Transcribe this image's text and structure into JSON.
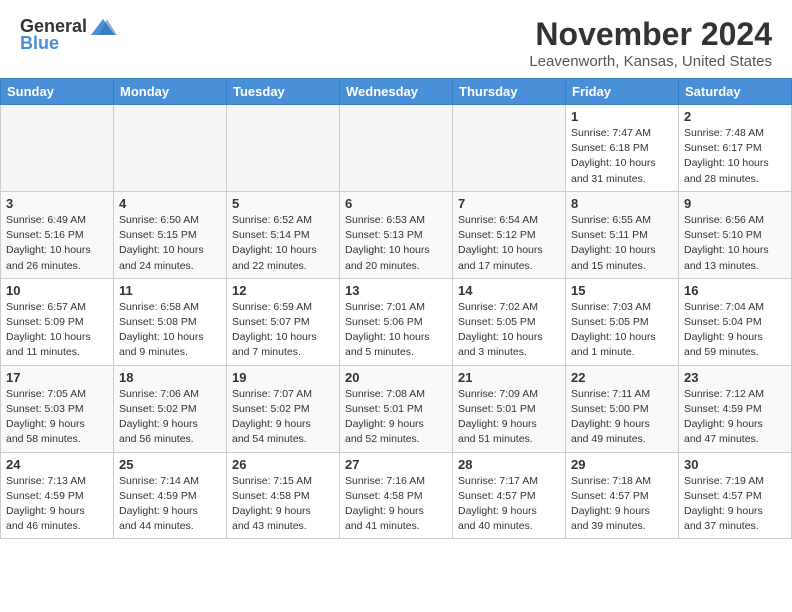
{
  "header": {
    "logo_general": "General",
    "logo_blue": "Blue",
    "month_title": "November 2024",
    "location": "Leavenworth, Kansas, United States"
  },
  "weekdays": [
    "Sunday",
    "Monday",
    "Tuesday",
    "Wednesday",
    "Thursday",
    "Friday",
    "Saturday"
  ],
  "weeks": [
    [
      {
        "day": "",
        "info": "",
        "empty": true
      },
      {
        "day": "",
        "info": "",
        "empty": true
      },
      {
        "day": "",
        "info": "",
        "empty": true
      },
      {
        "day": "",
        "info": "",
        "empty": true
      },
      {
        "day": "",
        "info": "",
        "empty": true
      },
      {
        "day": "1",
        "info": "Sunrise: 7:47 AM\nSunset: 6:18 PM\nDaylight: 10 hours\nand 31 minutes.",
        "empty": false
      },
      {
        "day": "2",
        "info": "Sunrise: 7:48 AM\nSunset: 6:17 PM\nDaylight: 10 hours\nand 28 minutes.",
        "empty": false
      }
    ],
    [
      {
        "day": "3",
        "info": "Sunrise: 6:49 AM\nSunset: 5:16 PM\nDaylight: 10 hours\nand 26 minutes.",
        "empty": false
      },
      {
        "day": "4",
        "info": "Sunrise: 6:50 AM\nSunset: 5:15 PM\nDaylight: 10 hours\nand 24 minutes.",
        "empty": false
      },
      {
        "day": "5",
        "info": "Sunrise: 6:52 AM\nSunset: 5:14 PM\nDaylight: 10 hours\nand 22 minutes.",
        "empty": false
      },
      {
        "day": "6",
        "info": "Sunrise: 6:53 AM\nSunset: 5:13 PM\nDaylight: 10 hours\nand 20 minutes.",
        "empty": false
      },
      {
        "day": "7",
        "info": "Sunrise: 6:54 AM\nSunset: 5:12 PM\nDaylight: 10 hours\nand 17 minutes.",
        "empty": false
      },
      {
        "day": "8",
        "info": "Sunrise: 6:55 AM\nSunset: 5:11 PM\nDaylight: 10 hours\nand 15 minutes.",
        "empty": false
      },
      {
        "day": "9",
        "info": "Sunrise: 6:56 AM\nSunset: 5:10 PM\nDaylight: 10 hours\nand 13 minutes.",
        "empty": false
      }
    ],
    [
      {
        "day": "10",
        "info": "Sunrise: 6:57 AM\nSunset: 5:09 PM\nDaylight: 10 hours\nand 11 minutes.",
        "empty": false
      },
      {
        "day": "11",
        "info": "Sunrise: 6:58 AM\nSunset: 5:08 PM\nDaylight: 10 hours\nand 9 minutes.",
        "empty": false
      },
      {
        "day": "12",
        "info": "Sunrise: 6:59 AM\nSunset: 5:07 PM\nDaylight: 10 hours\nand 7 minutes.",
        "empty": false
      },
      {
        "day": "13",
        "info": "Sunrise: 7:01 AM\nSunset: 5:06 PM\nDaylight: 10 hours\nand 5 minutes.",
        "empty": false
      },
      {
        "day": "14",
        "info": "Sunrise: 7:02 AM\nSunset: 5:05 PM\nDaylight: 10 hours\nand 3 minutes.",
        "empty": false
      },
      {
        "day": "15",
        "info": "Sunrise: 7:03 AM\nSunset: 5:05 PM\nDaylight: 10 hours\nand 1 minute.",
        "empty": false
      },
      {
        "day": "16",
        "info": "Sunrise: 7:04 AM\nSunset: 5:04 PM\nDaylight: 9 hours\nand 59 minutes.",
        "empty": false
      }
    ],
    [
      {
        "day": "17",
        "info": "Sunrise: 7:05 AM\nSunset: 5:03 PM\nDaylight: 9 hours\nand 58 minutes.",
        "empty": false
      },
      {
        "day": "18",
        "info": "Sunrise: 7:06 AM\nSunset: 5:02 PM\nDaylight: 9 hours\nand 56 minutes.",
        "empty": false
      },
      {
        "day": "19",
        "info": "Sunrise: 7:07 AM\nSunset: 5:02 PM\nDaylight: 9 hours\nand 54 minutes.",
        "empty": false
      },
      {
        "day": "20",
        "info": "Sunrise: 7:08 AM\nSunset: 5:01 PM\nDaylight: 9 hours\nand 52 minutes.",
        "empty": false
      },
      {
        "day": "21",
        "info": "Sunrise: 7:09 AM\nSunset: 5:01 PM\nDaylight: 9 hours\nand 51 minutes.",
        "empty": false
      },
      {
        "day": "22",
        "info": "Sunrise: 7:11 AM\nSunset: 5:00 PM\nDaylight: 9 hours\nand 49 minutes.",
        "empty": false
      },
      {
        "day": "23",
        "info": "Sunrise: 7:12 AM\nSunset: 4:59 PM\nDaylight: 9 hours\nand 47 minutes.",
        "empty": false
      }
    ],
    [
      {
        "day": "24",
        "info": "Sunrise: 7:13 AM\nSunset: 4:59 PM\nDaylight: 9 hours\nand 46 minutes.",
        "empty": false
      },
      {
        "day": "25",
        "info": "Sunrise: 7:14 AM\nSunset: 4:59 PM\nDaylight: 9 hours\nand 44 minutes.",
        "empty": false
      },
      {
        "day": "26",
        "info": "Sunrise: 7:15 AM\nSunset: 4:58 PM\nDaylight: 9 hours\nand 43 minutes.",
        "empty": false
      },
      {
        "day": "27",
        "info": "Sunrise: 7:16 AM\nSunset: 4:58 PM\nDaylight: 9 hours\nand 41 minutes.",
        "empty": false
      },
      {
        "day": "28",
        "info": "Sunrise: 7:17 AM\nSunset: 4:57 PM\nDaylight: 9 hours\nand 40 minutes.",
        "empty": false
      },
      {
        "day": "29",
        "info": "Sunrise: 7:18 AM\nSunset: 4:57 PM\nDaylight: 9 hours\nand 39 minutes.",
        "empty": false
      },
      {
        "day": "30",
        "info": "Sunrise: 7:19 AM\nSunset: 4:57 PM\nDaylight: 9 hours\nand 37 minutes.",
        "empty": false
      }
    ]
  ]
}
